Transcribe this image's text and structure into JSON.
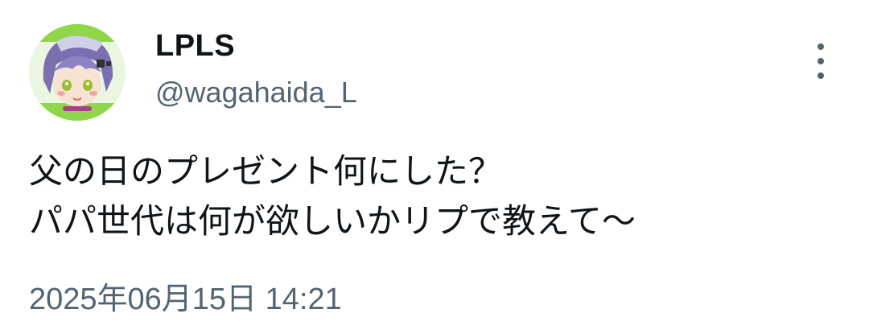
{
  "author": {
    "display_name": "LPLS",
    "handle": "@wagahaida_L",
    "avatar": "anime-character-avatar"
  },
  "tweet": {
    "lines": [
      "父の日のプレゼント何にした？",
      "パパ世代は何が欲しいかリプで教えて〜"
    ],
    "timestamp": "2025年06月15日 14:21"
  },
  "icons": {
    "more": "vertical-ellipsis-icon"
  },
  "colors": {
    "primary_text": "#0f1419",
    "secondary_text": "#536471",
    "background": "#ffffff"
  }
}
